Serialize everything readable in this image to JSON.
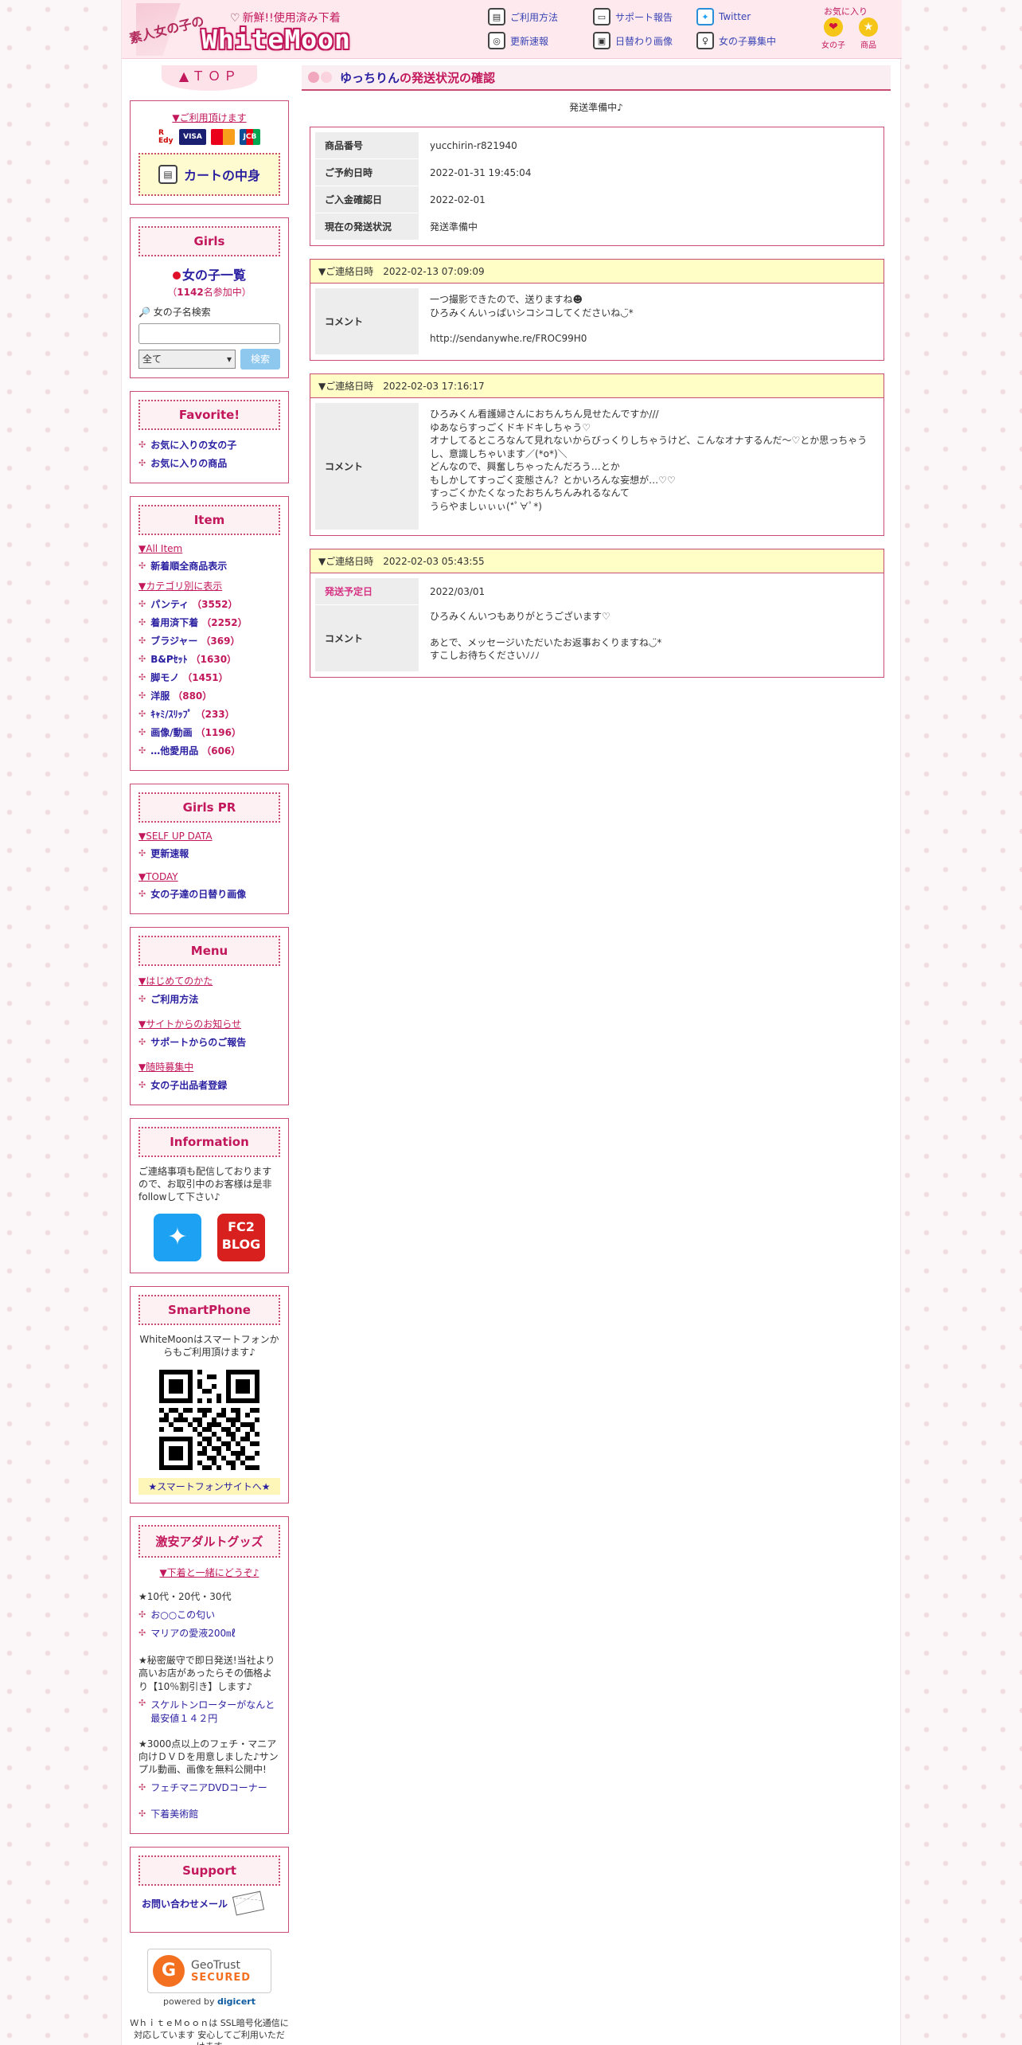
{
  "header": {
    "logo_sub": "素人女の子の",
    "logo_main": "WhiteMoon",
    "tagline": "新鮮!!使用済み下着",
    "nav": [
      {
        "label": "ご利用方法",
        "icon": "guide-icon"
      },
      {
        "label": "サポート報告",
        "icon": "monitor-icon"
      },
      {
        "label": "Twitter",
        "icon": "twitter-icon"
      },
      {
        "label": "更新速報",
        "icon": "camera-icon"
      },
      {
        "label": "日替わり画像",
        "icon": "floppy-icon"
      },
      {
        "label": "女の子募集中",
        "icon": "recruit-icon"
      }
    ],
    "favorites": {
      "title": "お気に入り",
      "girls": "女の子",
      "items": "商品"
    }
  },
  "sidebar": {
    "top_label": "▲ＴＯＰ",
    "payment": {
      "title": "▼ご利用頂けます",
      "cart_label": "カートの中身",
      "cards": [
        "R Edy",
        "VISA",
        "MC",
        "JCB"
      ]
    },
    "girls": {
      "title": "Girls",
      "list_label": "女の子一覧",
      "count_prefix": "（",
      "count_value": "1142",
      "count_suffix": "名参加中）",
      "search_label": "女の子名検索",
      "select_value": "全て",
      "search_button": "検索"
    },
    "favorite": {
      "title": "Favorite!",
      "items": [
        "お気に入りの女の子",
        "お気に入りの商品"
      ]
    },
    "item": {
      "title": "Item",
      "all_label": "▼All Item",
      "all_link": "新着順全商品表示",
      "category_label": "▼カテゴリ別に表示",
      "categories": [
        {
          "name": "パンティ",
          "count": "（3552）"
        },
        {
          "name": "着用済下着",
          "count": "（2252）"
        },
        {
          "name": "ブラジャー",
          "count": "（369）"
        },
        {
          "name": "B&Pｾｯﾄ",
          "count": "（1630）"
        },
        {
          "name": "脚モノ",
          "count": "（1451）"
        },
        {
          "name": "洋服",
          "count": "（880）"
        },
        {
          "name": "ｷｬﾐ/ｽﾘｯﾌﾟ",
          "count": "（233）"
        },
        {
          "name": "画像/動画",
          "count": "（1196）"
        },
        {
          "name": "…他愛用品",
          "count": "（606）"
        }
      ]
    },
    "girls_pr": {
      "title": "Girls PR",
      "selfup_label": "▼SELF UP DATA",
      "selfup_link": "更新速報",
      "today_label": "▼TODAY",
      "today_link": "女の子達の日替り画像"
    },
    "menu": {
      "title": "Menu",
      "sections": [
        {
          "label": "▼はじめてのかた",
          "link": "ご利用方法"
        },
        {
          "label": "▼サイトからのお知らせ",
          "link": "サポートからのご報告"
        },
        {
          "label": "▼随時募集中",
          "link": "女の子出品者登録"
        }
      ]
    },
    "information": {
      "title": "Information",
      "text": "ご連絡事項も配信しておりますので、お取引中のお客様は是非followして下さい♪",
      "fc2_label": "FC2",
      "blog_label": "BLOG"
    },
    "smartphone": {
      "title": "SmartPhone",
      "text": "WhiteMoonはスマートフォンからもご利用頂けます♪",
      "link": "★スマートフォンサイトへ★"
    },
    "goods": {
      "title": "激安アダルトグッズ",
      "subtitle": "▼下着と一緒にどうぞ♪",
      "age_text": "★10代・20代・30代",
      "links1": [
        "お○○この匂い",
        "マリアの愛液200㎖"
      ],
      "text2": "★秘密厳守で即日発送!当社より高いお店があったらその価格より【10％割引き】します♪",
      "link2": "スケルトンローターがなんと最安値１４２円",
      "text3": "★3000点以上のフェチ・マニア向けＤＶＤを用意しました♪サンプル動画、画像を無料公開中!",
      "link3": "フェチマニアDVDコーナー",
      "link4": "下着美術館"
    },
    "support": {
      "title": "Support",
      "mail_label": "お問い合わせメール"
    },
    "ssl": {
      "geo_brand": "GeoTrust",
      "geo_secured": "SECURED",
      "powered_by": "powered by",
      "powered_brand": "digicert",
      "text": "ＷｈｉｔｅＭｏｏｎは SSL暗号化通信に対応しています 安心してご利用いただけます"
    }
  },
  "main": {
    "title_name": "ゆっちりん",
    "title_rest": " の発送状況の確認",
    "status_line": "発送準備中♪",
    "info": [
      {
        "key": "商品番号",
        "value": "yucchirin-r821940"
      },
      {
        "key": "ご予約日時",
        "value": "2022-01-31 19:45:04"
      },
      {
        "key": "ご入金確認日",
        "value": "2022-02-01"
      },
      {
        "key": "現在の発送状況",
        "value": "発送準備中"
      }
    ],
    "messages": [
      {
        "head": "▼ご連絡日時　2022-02-13 07:09:09",
        "rows": [
          {
            "key": "コメント",
            "lines": [
              "一つ撮影できたので、送りますね☻",
              "ひろみくんいっぱいシコシコしてくださいね◡̈*",
              "",
              "http://sendanywhe.re/FROC99H0"
            ]
          }
        ]
      },
      {
        "head": "▼ご連絡日時　2022-02-03 17:16:17",
        "rows": [
          {
            "key": "コメント",
            "lines": [
              "ひろみくん看護婦さんにおちんちん見せたんですか///",
              "ゆあならすっごくドキドキしちゃう♡",
              "オナしてるところなんて見れないからびっくりしちゃうけど、こんなオナするんだ〜♡とか思っちゃうし、意識しちゃいます／(*o*)＼",
              "どんなので、興奮しちゃったんだろう…とか",
              "もしかしてすっごく変態さん？とかいろんな妄想が…♡♡",
              "すっごくかたくなったおちんちんみれるなんて",
              "うらやましぃぃぃ(*ﾟ∀ﾟ*)"
            ]
          }
        ]
      },
      {
        "head": "▼ご連絡日時　2022-02-03 05:43:55",
        "rows": [
          {
            "key": "発送予定日",
            "lines": [
              "2022/03/01"
            ],
            "pink": true
          },
          {
            "key": "コメント",
            "lines": [
              "ひろみくんいつもありがとうございます♡",
              "",
              "あとで、メッセージいただいたお返事おくりますね◡̈*",
              "すこしお待ちくださいﾉﾉﾉ"
            ]
          }
        ]
      }
    ]
  }
}
